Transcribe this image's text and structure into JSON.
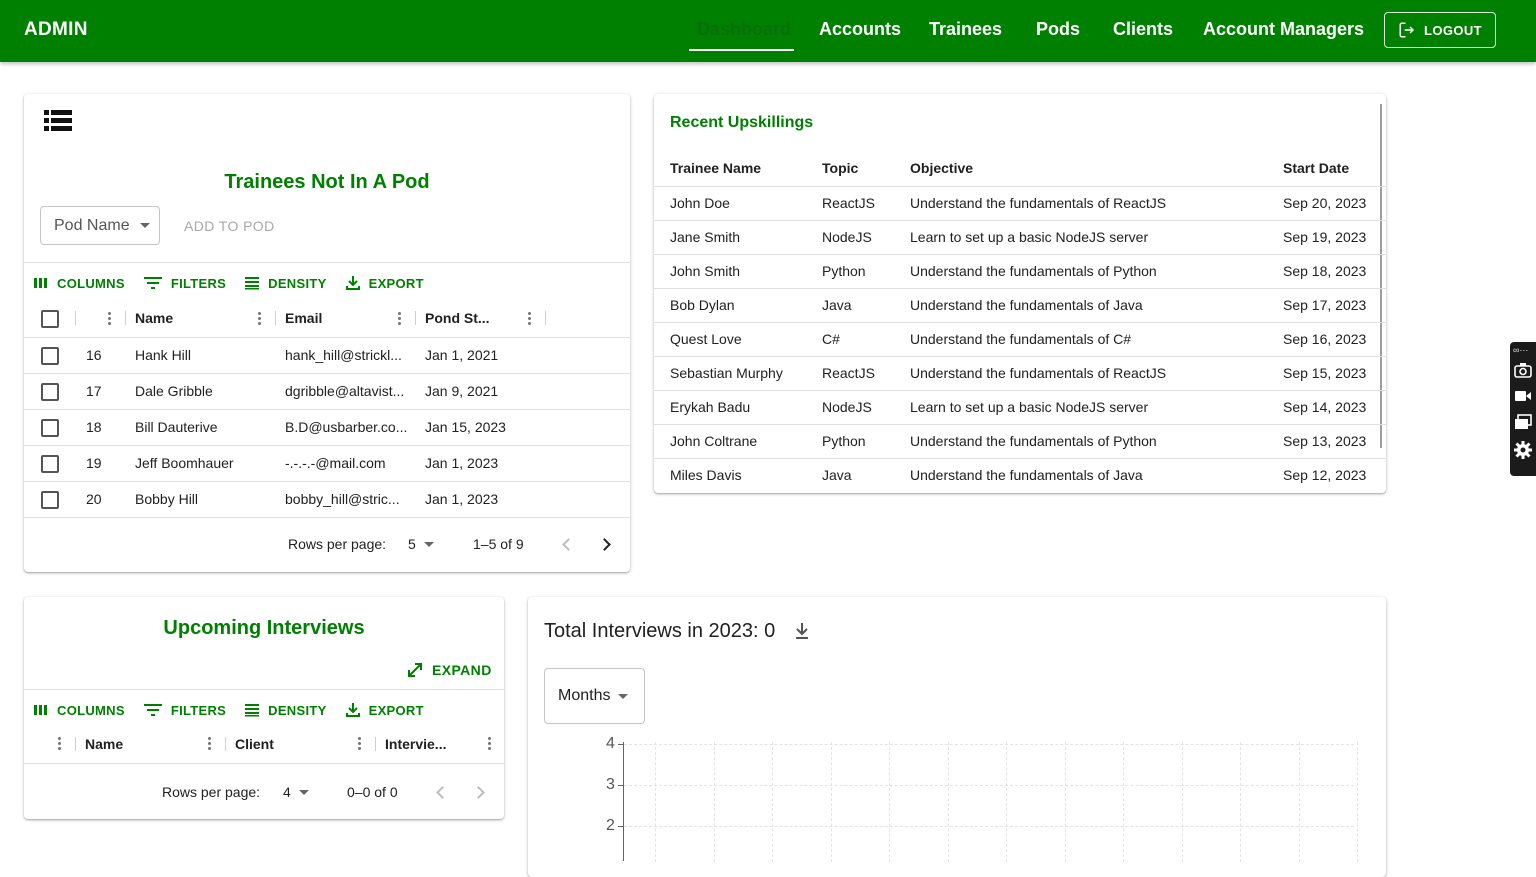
{
  "appbar": {
    "brand": "ADMIN",
    "nav": [
      "Dashboard",
      "Accounts",
      "Trainees",
      "Pods",
      "Clients",
      "Account Managers"
    ],
    "active": "Dashboard",
    "logout": "LOGOUT"
  },
  "trainees_card": {
    "title": "Trainees Not In A Pod",
    "pod_select_label": "Pod Name",
    "add_button": "ADD TO POD",
    "toolbar": [
      "COLUMNS",
      "FILTERS",
      "DENSITY",
      "EXPORT"
    ],
    "columns": [
      "Name",
      "Email",
      "Pond St..."
    ],
    "rows": [
      {
        "id": "16",
        "name": "Hank Hill",
        "email": "hank_hill@strickl...",
        "start": "Jan 1, 2021"
      },
      {
        "id": "17",
        "name": "Dale Gribble",
        "email": "dgribble@altavist...",
        "start": "Jan 9, 2021"
      },
      {
        "id": "18",
        "name": "Bill Dauterive",
        "email": "B.D@usbarber.co...",
        "start": "Jan 15, 2023"
      },
      {
        "id": "19",
        "name": "Jeff Boomhauer",
        "email": "-.-.-.-@mail.com",
        "start": "Jan 1, 2023"
      },
      {
        "id": "20",
        "name": "Bobby Hill",
        "email": "bobby_hill@stric...",
        "start": "Jan 1, 2023"
      }
    ],
    "pager": {
      "rows_per_page_label": "Rows per page:",
      "rows_per_page": "5",
      "range": "1–5 of 9"
    }
  },
  "upskillings_card": {
    "title": "Recent Upskillings",
    "columns": [
      "Trainee Name",
      "Topic",
      "Objective",
      "Start Date"
    ],
    "rows": [
      {
        "name": "John Doe",
        "topic": "ReactJS",
        "objective": "Understand the fundamentals of ReactJS",
        "date": "Sep 20, 2023"
      },
      {
        "name": "Jane Smith",
        "topic": "NodeJS",
        "objective": "Learn to set up a basic NodeJS server",
        "date": "Sep 19, 2023"
      },
      {
        "name": "John Smith",
        "topic": "Python",
        "objective": "Understand the fundamentals of Python",
        "date": "Sep 18, 2023"
      },
      {
        "name": "Bob Dylan",
        "topic": "Java",
        "objective": "Understand the fundamentals of Java",
        "date": "Sep 17, 2023"
      },
      {
        "name": "Quest Love",
        "topic": "C#",
        "objective": "Understand the fundamentals of C#",
        "date": "Sep 16, 2023"
      },
      {
        "name": "Sebastian Murphy",
        "topic": "ReactJS",
        "objective": "Understand the fundamentals of ReactJS",
        "date": "Sep 15, 2023"
      },
      {
        "name": "Erykah Badu",
        "topic": "NodeJS",
        "objective": "Learn to set up a basic NodeJS server",
        "date": "Sep 14, 2023"
      },
      {
        "name": "John Coltrane",
        "topic": "Python",
        "objective": "Understand the fundamentals of Python",
        "date": "Sep 13, 2023"
      },
      {
        "name": "Miles Davis",
        "topic": "Java",
        "objective": "Understand the fundamentals of Java",
        "date": "Sep 12, 2023"
      }
    ]
  },
  "interviews_card": {
    "title": "Upcoming Interviews",
    "expand": "EXPAND",
    "toolbar": [
      "COLUMNS",
      "FILTERS",
      "DENSITY",
      "EXPORT"
    ],
    "columns": [
      "Name",
      "Client",
      "Intervie..."
    ],
    "pager": {
      "rows_per_page_label": "Rows per page:",
      "rows_per_page": "4",
      "range": "0–0 of 0"
    }
  },
  "total_card": {
    "title": "Total Interviews in 2023: 0",
    "period_select": "Months"
  },
  "chart_data": {
    "type": "bar",
    "title": "",
    "y_ticks": [
      "4",
      "3",
      "2"
    ],
    "ylim": [
      0,
      4
    ],
    "grid": true
  },
  "colors": {
    "primary": "#008000",
    "header_bg": "#008000"
  }
}
